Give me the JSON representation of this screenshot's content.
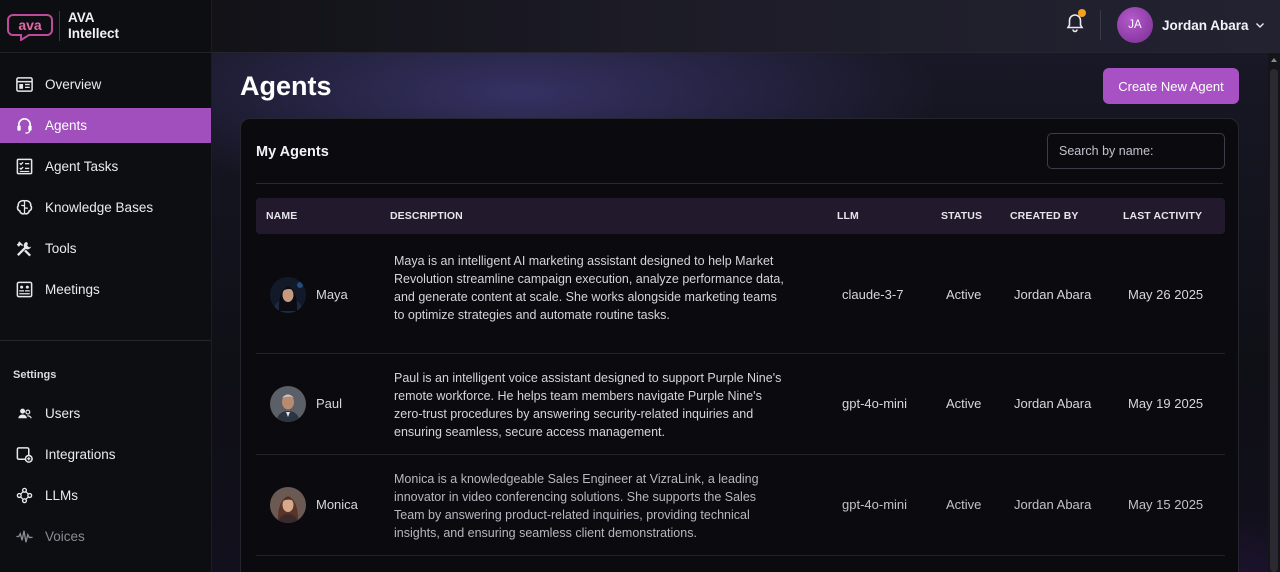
{
  "brand": {
    "logo_text": "ava",
    "line1": "AVA",
    "line2": "Intellect"
  },
  "sidebar": {
    "items": [
      {
        "label": "Overview",
        "icon": "overview-icon"
      },
      {
        "label": "Agents",
        "icon": "headset-icon",
        "active": true
      },
      {
        "label": "Agent Tasks",
        "icon": "checklist-icon"
      },
      {
        "label": "Knowledge Bases",
        "icon": "brain-icon"
      },
      {
        "label": "Tools",
        "icon": "tools-icon"
      },
      {
        "label": "Meetings",
        "icon": "meetings-icon"
      }
    ],
    "settings_label": "Settings",
    "settings_items": [
      {
        "label": "Users",
        "icon": "users-icon"
      },
      {
        "label": "Integrations",
        "icon": "integrations-icon"
      },
      {
        "label": "LLMs",
        "icon": "llm-icon"
      },
      {
        "label": "Voices",
        "icon": "waveform-icon"
      }
    ]
  },
  "header": {
    "user_initials": "JA",
    "user_name": "Jordan Abara",
    "notification_dot_color": "#f3a21a"
  },
  "main": {
    "title": "Agents",
    "create_button": "Create New Agent",
    "card_title": "My Agents",
    "search_placeholder": "Search by name:",
    "columns": [
      "NAME",
      "DESCRIPTION",
      "LLM",
      "STATUS",
      "CREATED BY",
      "LAST ACTIVITY"
    ],
    "rows": [
      {
        "name": "Maya",
        "description": "Maya is an intelligent AI marketing assistant designed to help Market Revolution streamline campaign execution, analyze performance data, and generate content at scale. She works alongside marketing teams to optimize strategies and automate routine tasks.",
        "llm": "claude-3-7",
        "status": "Active",
        "created_by": "Jordan Abara",
        "last_activity": "May 26 2025"
      },
      {
        "name": "Paul",
        "description": "Paul is an intelligent voice assistant designed to support Purple Nine's remote workforce. He helps team members navigate Purple Nine's zero-trust procedures by answering security-related inquiries and ensuring seamless, secure access management.",
        "llm": "gpt-4o-mini",
        "status": "Active",
        "created_by": "Jordan Abara",
        "last_activity": "May 19 2025"
      },
      {
        "name": "Monica",
        "description": "Monica is a knowledgeable Sales Engineer at VizraLink, a leading innovator in video conferencing solutions. She supports the Sales Team by answering product-related inquiries, providing technical insights, and ensuring seamless client demonstrations.",
        "llm": "gpt-4o-mini",
        "status": "Active",
        "created_by": "Jordan Abara",
        "last_activity": "May 15 2025"
      }
    ]
  },
  "colors": {
    "accent": "#a751c4",
    "active_nav": "#a04fbd"
  }
}
